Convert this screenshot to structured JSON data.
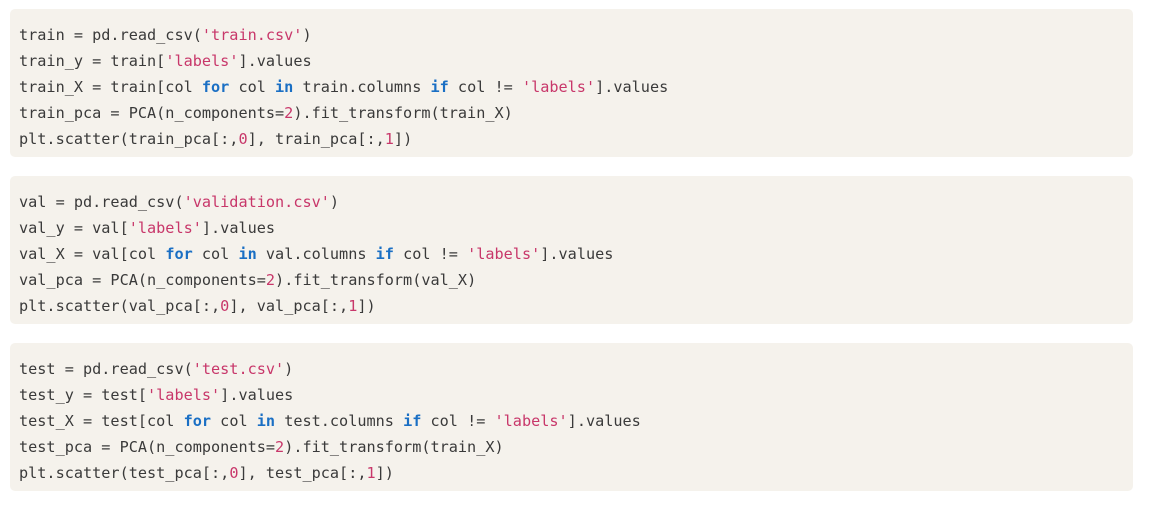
{
  "colors": {
    "block_background": "#f5f2ec",
    "text": "#3a3a3a",
    "string": "#c8376a",
    "number": "#c8376a",
    "keyword": "#1a6fc4"
  },
  "code_blocks": [
    {
      "lines": [
        [
          [
            "train = pd.read_csv(",
            "plain"
          ],
          [
            "'train.csv'",
            "str"
          ],
          [
            ")",
            "plain"
          ]
        ],
        [
          [
            "train_y = train[",
            "plain"
          ],
          [
            "'labels'",
            "str"
          ],
          [
            "].values",
            "plain"
          ]
        ],
        [
          [
            "train_X = train[col ",
            "plain"
          ],
          [
            "for",
            "kw"
          ],
          [
            " col ",
            "plain"
          ],
          [
            "in",
            "kw"
          ],
          [
            " train.columns ",
            "plain"
          ],
          [
            "if",
            "kw"
          ],
          [
            " col != ",
            "plain"
          ],
          [
            "'labels'",
            "str"
          ],
          [
            "].values",
            "plain"
          ]
        ],
        [
          [
            "train_pca = PCA(n_components=",
            "plain"
          ],
          [
            "2",
            "num"
          ],
          [
            ").fit_transform(train_X)",
            "plain"
          ]
        ],
        [
          [
            "plt.scatter(train_pca[:,",
            "plain"
          ],
          [
            "0",
            "num"
          ],
          [
            "], train_pca[:,",
            "plain"
          ],
          [
            "1",
            "num"
          ],
          [
            "])",
            "plain"
          ]
        ]
      ]
    },
    {
      "lines": [
        [
          [
            "val = pd.read_csv(",
            "plain"
          ],
          [
            "'validation.csv'",
            "str"
          ],
          [
            ")",
            "plain"
          ]
        ],
        [
          [
            "val_y = val[",
            "plain"
          ],
          [
            "'labels'",
            "str"
          ],
          [
            "].values",
            "plain"
          ]
        ],
        [
          [
            "val_X = val[col ",
            "plain"
          ],
          [
            "for",
            "kw"
          ],
          [
            " col ",
            "plain"
          ],
          [
            "in",
            "kw"
          ],
          [
            " val.columns ",
            "plain"
          ],
          [
            "if",
            "kw"
          ],
          [
            " col != ",
            "plain"
          ],
          [
            "'labels'",
            "str"
          ],
          [
            "].values",
            "plain"
          ]
        ],
        [
          [
            "val_pca = PCA(n_components=",
            "plain"
          ],
          [
            "2",
            "num"
          ],
          [
            ").fit_transform(val_X)",
            "plain"
          ]
        ],
        [
          [
            "plt.scatter(val_pca[:,",
            "plain"
          ],
          [
            "0",
            "num"
          ],
          [
            "], val_pca[:,",
            "plain"
          ],
          [
            "1",
            "num"
          ],
          [
            "])",
            "plain"
          ]
        ]
      ]
    },
    {
      "lines": [
        [
          [
            "test = pd.read_csv(",
            "plain"
          ],
          [
            "'test.csv'",
            "str"
          ],
          [
            ")",
            "plain"
          ]
        ],
        [
          [
            "test_y = test[",
            "plain"
          ],
          [
            "'labels'",
            "str"
          ],
          [
            "].values",
            "plain"
          ]
        ],
        [
          [
            "test_X = test[col ",
            "plain"
          ],
          [
            "for",
            "kw"
          ],
          [
            " col ",
            "plain"
          ],
          [
            "in",
            "kw"
          ],
          [
            " test.columns ",
            "plain"
          ],
          [
            "if",
            "kw"
          ],
          [
            " col != ",
            "plain"
          ],
          [
            "'labels'",
            "str"
          ],
          [
            "].values",
            "plain"
          ]
        ],
        [
          [
            "test_pca = PCA(n_components=",
            "plain"
          ],
          [
            "2",
            "num"
          ],
          [
            ").fit_transform(train_X)",
            "plain"
          ]
        ],
        [
          [
            "plt.scatter(test_pca[:,",
            "plain"
          ],
          [
            "0",
            "num"
          ],
          [
            "], test_pca[:,",
            "plain"
          ],
          [
            "1",
            "num"
          ],
          [
            "])",
            "plain"
          ]
        ]
      ]
    }
  ]
}
